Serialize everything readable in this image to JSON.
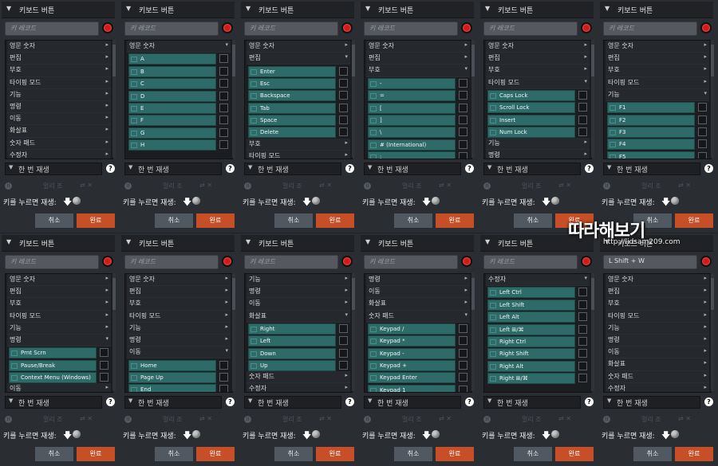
{
  "common": {
    "title": "키보드 버튼",
    "record_placeholder": "키 레코드",
    "play_mode": "한 번 재생",
    "help": "?",
    "pause_icon": "II",
    "gray_label": "멀리 조",
    "gray_icons": "⇄ ✕",
    "toggle_label": "키를 누르면 재생:",
    "toggle_arrow": "🡇",
    "cancel": "취소",
    "done": "완료",
    "expand_arrow": "▼"
  },
  "watermark": {
    "title": "따라해보기",
    "url": "http://lidsam209.com"
  },
  "panels": [
    {
      "record_value": "",
      "items": [
        {
          "t": "cat",
          "label": "영문 숫자",
          "chev": "▸"
        },
        {
          "t": "cat",
          "label": "편집",
          "chev": "▸"
        },
        {
          "t": "cat",
          "label": "부호",
          "chev": "▸"
        },
        {
          "t": "cat",
          "label": "타이핑 모드",
          "chev": "▸"
        },
        {
          "t": "cat",
          "label": "기능",
          "chev": "▸"
        },
        {
          "t": "cat",
          "label": "명령",
          "chev": "▸"
        },
        {
          "t": "cat",
          "label": "이동",
          "chev": "▸"
        },
        {
          "t": "cat",
          "label": "화살표",
          "chev": "▸"
        },
        {
          "t": "cat",
          "label": "숫자 패드",
          "chev": "▸"
        },
        {
          "t": "cat",
          "label": "수정자",
          "chev": "▸"
        }
      ]
    },
    {
      "record_value": "",
      "items": [
        {
          "t": "cat",
          "label": "영문 숫자",
          "chev": "▾"
        },
        {
          "t": "key",
          "label": "A"
        },
        {
          "t": "key",
          "label": "B"
        },
        {
          "t": "key",
          "label": "C"
        },
        {
          "t": "key",
          "label": "D"
        },
        {
          "t": "key",
          "label": "E"
        },
        {
          "t": "key",
          "label": "F"
        },
        {
          "t": "key",
          "label": "G"
        },
        {
          "t": "key",
          "label": "H"
        }
      ]
    },
    {
      "record_value": "",
      "items": [
        {
          "t": "cat",
          "label": "영문 숫자",
          "chev": "▸"
        },
        {
          "t": "cat",
          "label": "편집",
          "chev": "▾"
        },
        {
          "t": "key",
          "label": "Enter"
        },
        {
          "t": "key",
          "label": "Esc"
        },
        {
          "t": "key",
          "label": "Backspace"
        },
        {
          "t": "key",
          "label": "Tab"
        },
        {
          "t": "key",
          "label": "Space"
        },
        {
          "t": "key",
          "label": "Delete"
        },
        {
          "t": "cat",
          "label": "부호",
          "chev": "▸"
        },
        {
          "t": "cat",
          "label": "타이핑 모드",
          "chev": "▸"
        }
      ]
    },
    {
      "record_value": "",
      "items": [
        {
          "t": "cat",
          "label": "영문 숫자",
          "chev": "▸"
        },
        {
          "t": "cat",
          "label": "편집",
          "chev": "▸"
        },
        {
          "t": "cat",
          "label": "부호",
          "chev": "▾"
        },
        {
          "t": "key",
          "label": "-"
        },
        {
          "t": "key",
          "label": "="
        },
        {
          "t": "key",
          "label": "["
        },
        {
          "t": "key",
          "label": "]"
        },
        {
          "t": "key",
          "label": "\\"
        },
        {
          "t": "key",
          "label": "# (International)"
        },
        {
          "t": "key",
          "label": ";"
        }
      ]
    },
    {
      "record_value": "",
      "items": [
        {
          "t": "cat",
          "label": "영문 숫자",
          "chev": "▸"
        },
        {
          "t": "cat",
          "label": "편집",
          "chev": "▸"
        },
        {
          "t": "cat",
          "label": "부호",
          "chev": "▸"
        },
        {
          "t": "cat",
          "label": "타이핑 모드",
          "chev": "▾"
        },
        {
          "t": "key",
          "label": "Caps Lock"
        },
        {
          "t": "key",
          "label": "Scroll Lock"
        },
        {
          "t": "key",
          "label": "Insert"
        },
        {
          "t": "key",
          "label": "Num Lock"
        },
        {
          "t": "cat",
          "label": "기능",
          "chev": "▸"
        },
        {
          "t": "cat",
          "label": "명령",
          "chev": "▸"
        }
      ]
    },
    {
      "record_value": "",
      "items": [
        {
          "t": "cat",
          "label": "영문 숫자",
          "chev": "▸"
        },
        {
          "t": "cat",
          "label": "편집",
          "chev": "▸"
        },
        {
          "t": "cat",
          "label": "부호",
          "chev": "▸"
        },
        {
          "t": "cat",
          "label": "타이핑 모드",
          "chev": "▸"
        },
        {
          "t": "cat",
          "label": "기능",
          "chev": "▾"
        },
        {
          "t": "key",
          "label": "F1"
        },
        {
          "t": "key",
          "label": "F2"
        },
        {
          "t": "key",
          "label": "F3"
        },
        {
          "t": "key",
          "label": "F4"
        },
        {
          "t": "key",
          "label": "F5"
        }
      ]
    },
    {
      "record_value": "",
      "items": [
        {
          "t": "cat",
          "label": "영문 숫자",
          "chev": "▸"
        },
        {
          "t": "cat",
          "label": "편집",
          "chev": "▸"
        },
        {
          "t": "cat",
          "label": "부호",
          "chev": "▸"
        },
        {
          "t": "cat",
          "label": "타이핑 모드",
          "chev": "▸"
        },
        {
          "t": "cat",
          "label": "기능",
          "chev": "▸"
        },
        {
          "t": "cat",
          "label": "명령",
          "chev": "▾"
        },
        {
          "t": "key",
          "label": "Prnt Scrn"
        },
        {
          "t": "key",
          "label": "Pause/Break"
        },
        {
          "t": "key",
          "label": "Context Menu (Windows)"
        },
        {
          "t": "cat",
          "label": "이동",
          "chev": "▸"
        }
      ]
    },
    {
      "record_value": "",
      "items": [
        {
          "t": "cat",
          "label": "영문 숫자",
          "chev": "▸"
        },
        {
          "t": "cat",
          "label": "편집",
          "chev": "▸"
        },
        {
          "t": "cat",
          "label": "부호",
          "chev": "▸"
        },
        {
          "t": "cat",
          "label": "타이핑 모드",
          "chev": "▸"
        },
        {
          "t": "cat",
          "label": "기능",
          "chev": "▸"
        },
        {
          "t": "cat",
          "label": "명령",
          "chev": "▸"
        },
        {
          "t": "cat",
          "label": "이동",
          "chev": "▾"
        },
        {
          "t": "key",
          "label": "Home"
        },
        {
          "t": "key",
          "label": "Page Up"
        },
        {
          "t": "key",
          "label": "End"
        }
      ]
    },
    {
      "record_value": "",
      "items": [
        {
          "t": "cat",
          "label": "기능",
          "chev": "▸"
        },
        {
          "t": "cat",
          "label": "명령",
          "chev": "▸"
        },
        {
          "t": "cat",
          "label": "이동",
          "chev": "▸"
        },
        {
          "t": "cat",
          "label": "화살표",
          "chev": "▾"
        },
        {
          "t": "key",
          "label": "Right"
        },
        {
          "t": "key",
          "label": "Left"
        },
        {
          "t": "key",
          "label": "Down"
        },
        {
          "t": "key",
          "label": "Up"
        },
        {
          "t": "cat",
          "label": "숫자 패드",
          "chev": "▸"
        },
        {
          "t": "cat",
          "label": "수정자",
          "chev": "▸"
        }
      ]
    },
    {
      "record_value": "",
      "items": [
        {
          "t": "cat",
          "label": "명령",
          "chev": "▸"
        },
        {
          "t": "cat",
          "label": "이동",
          "chev": "▸"
        },
        {
          "t": "cat",
          "label": "화살표",
          "chev": "▸"
        },
        {
          "t": "cat",
          "label": "숫자 패드",
          "chev": "▾"
        },
        {
          "t": "key",
          "label": "Keypad /"
        },
        {
          "t": "key",
          "label": "Keypad *"
        },
        {
          "t": "key",
          "label": "Keypad -"
        },
        {
          "t": "key",
          "label": "Keypad +"
        },
        {
          "t": "key",
          "label": "Keypad Enter"
        },
        {
          "t": "key",
          "label": "Keypad 1"
        }
      ]
    },
    {
      "record_value": "",
      "items": [
        {
          "t": "cat",
          "label": "수정자",
          "chev": "▾"
        },
        {
          "t": "key",
          "label": "Left Ctrl"
        },
        {
          "t": "key",
          "label": "Left Shift"
        },
        {
          "t": "key",
          "label": "Left Alt"
        },
        {
          "t": "key",
          "label": "Left ⊞/⌘"
        },
        {
          "t": "key",
          "label": "Right Ctrl"
        },
        {
          "t": "key",
          "label": "Right Shift"
        },
        {
          "t": "key",
          "label": "Right Alt"
        },
        {
          "t": "key",
          "label": "Right ⊞/⌘"
        }
      ]
    },
    {
      "record_value": "L Shift + W",
      "items": [
        {
          "t": "cat",
          "label": "영문 숫자",
          "chev": "▸"
        },
        {
          "t": "cat",
          "label": "편집",
          "chev": "▸"
        },
        {
          "t": "cat",
          "label": "부호",
          "chev": "▸"
        },
        {
          "t": "cat",
          "label": "타이핑 모드",
          "chev": "▸"
        },
        {
          "t": "cat",
          "label": "기능",
          "chev": "▸"
        },
        {
          "t": "cat",
          "label": "명령",
          "chev": "▸"
        },
        {
          "t": "cat",
          "label": "이동",
          "chev": "▸"
        },
        {
          "t": "cat",
          "label": "화살표",
          "chev": "▸"
        },
        {
          "t": "cat",
          "label": "숫자 패드",
          "chev": "▸"
        },
        {
          "t": "cat",
          "label": "수정자",
          "chev": "▸"
        }
      ]
    }
  ]
}
